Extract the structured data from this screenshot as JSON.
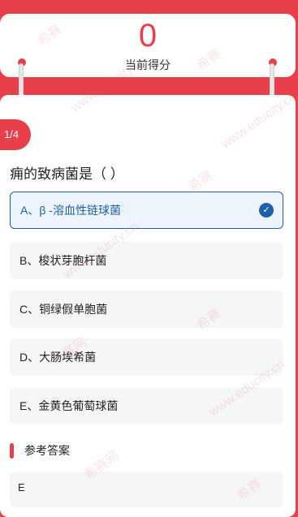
{
  "score": {
    "value": "0",
    "label": "当前得分"
  },
  "progress": "1/4",
  "question": "痈的致病菌是（ ）",
  "options": [
    {
      "text": "A、β -溶血性链球菌",
      "selected": true
    },
    {
      "text": "B、梭状芽胞杆菌",
      "selected": false
    },
    {
      "text": "C、铜绿假单胞菌",
      "selected": false
    },
    {
      "text": "D、大肠埃希菌",
      "selected": false
    },
    {
      "text": "E、金黄色葡萄球菌",
      "selected": false
    }
  ],
  "check_icon": "check-icon",
  "answer": {
    "title": "参考答案",
    "value": "E"
  },
  "watermarks": [
    "希赛",
    "www.educity.cn",
    "希赛网"
  ],
  "colors": {
    "brand": "#e8404a",
    "selected": "#1f5fa8"
  }
}
